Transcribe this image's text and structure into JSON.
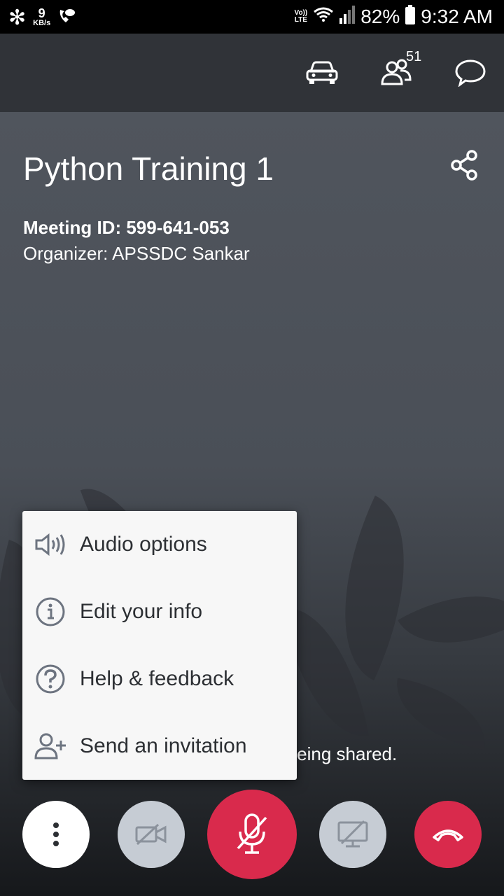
{
  "status_bar": {
    "speed_value": "9",
    "speed_unit": "KB/s",
    "network_label_top": "Vo))",
    "network_label_bottom": "LTE",
    "battery": "82%",
    "time": "9:32 AM"
  },
  "top_bar": {
    "participants_count": "51"
  },
  "meeting": {
    "title": "Python Training 1",
    "meeting_id": "Meeting ID: 599-641-053",
    "organizer": "Organizer: APSSDC Sankar",
    "shared_notice": "e being shared."
  },
  "menu": {
    "items": [
      {
        "label": "Audio options",
        "icon": "speaker-icon"
      },
      {
        "label": "Edit your info",
        "icon": "info-icon"
      },
      {
        "label": "Help & feedback",
        "icon": "help-icon"
      },
      {
        "label": "Send an invitation",
        "icon": "add-person-icon"
      }
    ]
  },
  "colors": {
    "accent_red": "#d92a4c",
    "inactive_gray": "#c6ccd4"
  }
}
